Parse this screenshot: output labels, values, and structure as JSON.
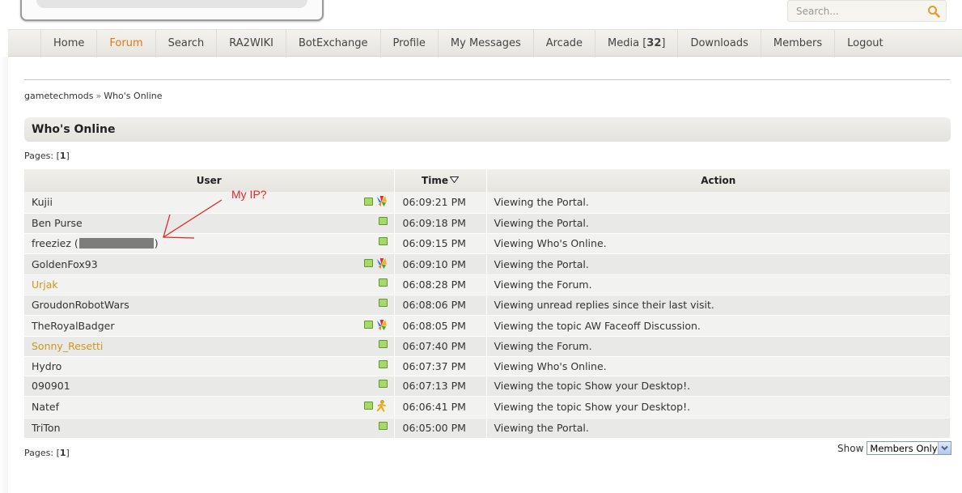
{
  "header": {
    "search_placeholder": "Search..."
  },
  "nav": [
    {
      "label": "Home",
      "active": false
    },
    {
      "label": "Forum",
      "active": true
    },
    {
      "label": "Search",
      "active": false
    },
    {
      "label": "RA2WIKI",
      "active": false
    },
    {
      "label": "BotExchange",
      "active": false
    },
    {
      "label": "Profile",
      "active": false
    },
    {
      "label": "My Messages",
      "active": false
    },
    {
      "label": "Arcade",
      "active": false
    },
    {
      "label": "Media [",
      "badge": "32",
      "suffix": "]",
      "active": false
    },
    {
      "label": "Downloads",
      "active": false
    },
    {
      "label": "Members",
      "active": false
    },
    {
      "label": "Logout",
      "active": false
    }
  ],
  "breadcrumb": {
    "home": "gametechmods",
    "separator": "»",
    "current": "Who's Online"
  },
  "page_title": "Who's Online",
  "pages": {
    "label": "Pages:",
    "open": "[",
    "current": "1",
    "close": "]"
  },
  "table": {
    "headers": {
      "user": "User",
      "time": "Time",
      "action": "Action"
    },
    "rows": [
      {
        "user": "Kujii",
        "time": "06:09:21 PM",
        "action": "Viewing the Portal.",
        "msn": true,
        "aim": false,
        "mod": false
      },
      {
        "user": "Ben Purse",
        "time": "06:09:18 PM",
        "action": "Viewing the Portal.",
        "msn": false,
        "aim": false,
        "mod": false
      },
      {
        "user": "freeziez",
        "time": "06:09:15 PM",
        "action": "Viewing Who's Online.",
        "msn": false,
        "aim": false,
        "mod": false,
        "ip_masked": true,
        "ip_open": " (",
        "ip_close": ")"
      },
      {
        "user": "GoldenFox93",
        "time": "06:09:10 PM",
        "action": "Viewing the Portal.",
        "msn": true,
        "aim": false,
        "mod": false
      },
      {
        "user": "Urjak",
        "time": "06:08:28 PM",
        "action": "Viewing the Forum.",
        "msn": false,
        "aim": false,
        "mod": true
      },
      {
        "user": "GroudonRobotWars",
        "time": "06:08:06 PM",
        "action": "Viewing unread replies since their last visit.",
        "msn": false,
        "aim": false,
        "mod": false
      },
      {
        "user": "TheRoyalBadger",
        "time": "06:08:05 PM",
        "action": "Viewing the topic AW Faceoff Discussion.",
        "msn": true,
        "aim": false,
        "mod": false
      },
      {
        "user": "Sonny_Resetti",
        "time": "06:07:40 PM",
        "action": "Viewing the Forum.",
        "msn": false,
        "aim": false,
        "mod": true
      },
      {
        "user": "Hydro",
        "time": "06:07:37 PM",
        "action": "Viewing Who's Online.",
        "msn": false,
        "aim": false,
        "mod": false
      },
      {
        "user": "090901",
        "time": "06:07:13 PM",
        "action": "Viewing the topic Show your Desktop!.",
        "msn": false,
        "aim": false,
        "mod": false
      },
      {
        "user": "Natef",
        "time": "06:06:41 PM",
        "action": "Viewing the topic Show your Desktop!.",
        "msn": false,
        "aim": true,
        "mod": false
      },
      {
        "user": "TriTon",
        "time": "06:05:00 PM",
        "action": "Viewing the Portal.",
        "msn": false,
        "aim": false,
        "mod": false
      }
    ]
  },
  "annotation": {
    "text": "My IP?",
    "color": "#e32626"
  },
  "show_filter": {
    "label": "Show",
    "selected": "Members Only"
  },
  "colors": {
    "accent": "#e07a10",
    "mod_user": "#d0961a",
    "online": "#a6d86a"
  },
  "icons": {
    "search": "magnifier-icon",
    "online": "online-status-icon",
    "msn": "msn-butterfly-icon",
    "aim": "aim-running-man-icon",
    "sort": "sort-desc-triangle-icon"
  }
}
